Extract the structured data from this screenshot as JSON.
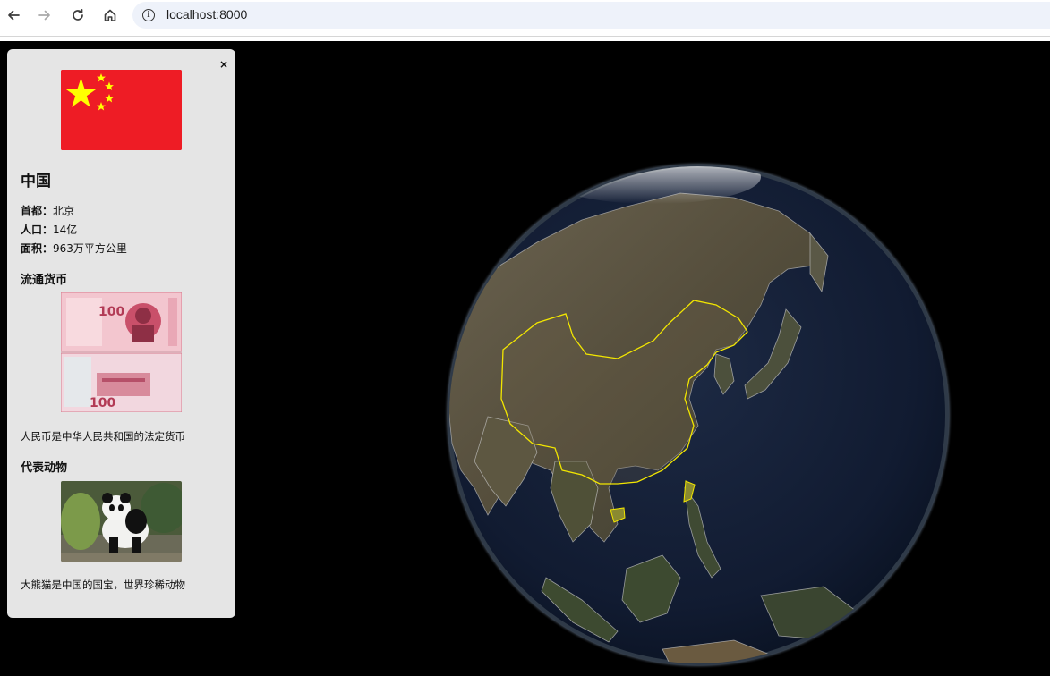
{
  "browser": {
    "url": "localhost:8000",
    "back_icon": "arrow-left-icon",
    "forward_icon": "arrow-right-icon",
    "reload_icon": "reload-icon",
    "home_icon": "home-icon",
    "info_icon": "info-icon"
  },
  "panel": {
    "close_label": "×",
    "country": "中国",
    "facts": [
      {
        "key": "首都：",
        "value": "北京"
      },
      {
        "key": "人口：",
        "value": "14亿"
      },
      {
        "key": "面积：",
        "value": "963万平方公里"
      }
    ],
    "currency_title": "流通货币",
    "currency_caption": "人民币是中华人民共和国的法定货币",
    "banknote_text": "100",
    "animal_title": "代表动物",
    "animal_caption": "大熊猫是中国的国宝，世界珍稀动物"
  },
  "colors": {
    "flag_red": "#ee1c25",
    "flag_star": "#ffff00",
    "highlight_border": "#f2e600",
    "ocean": "#0f1a2e"
  }
}
